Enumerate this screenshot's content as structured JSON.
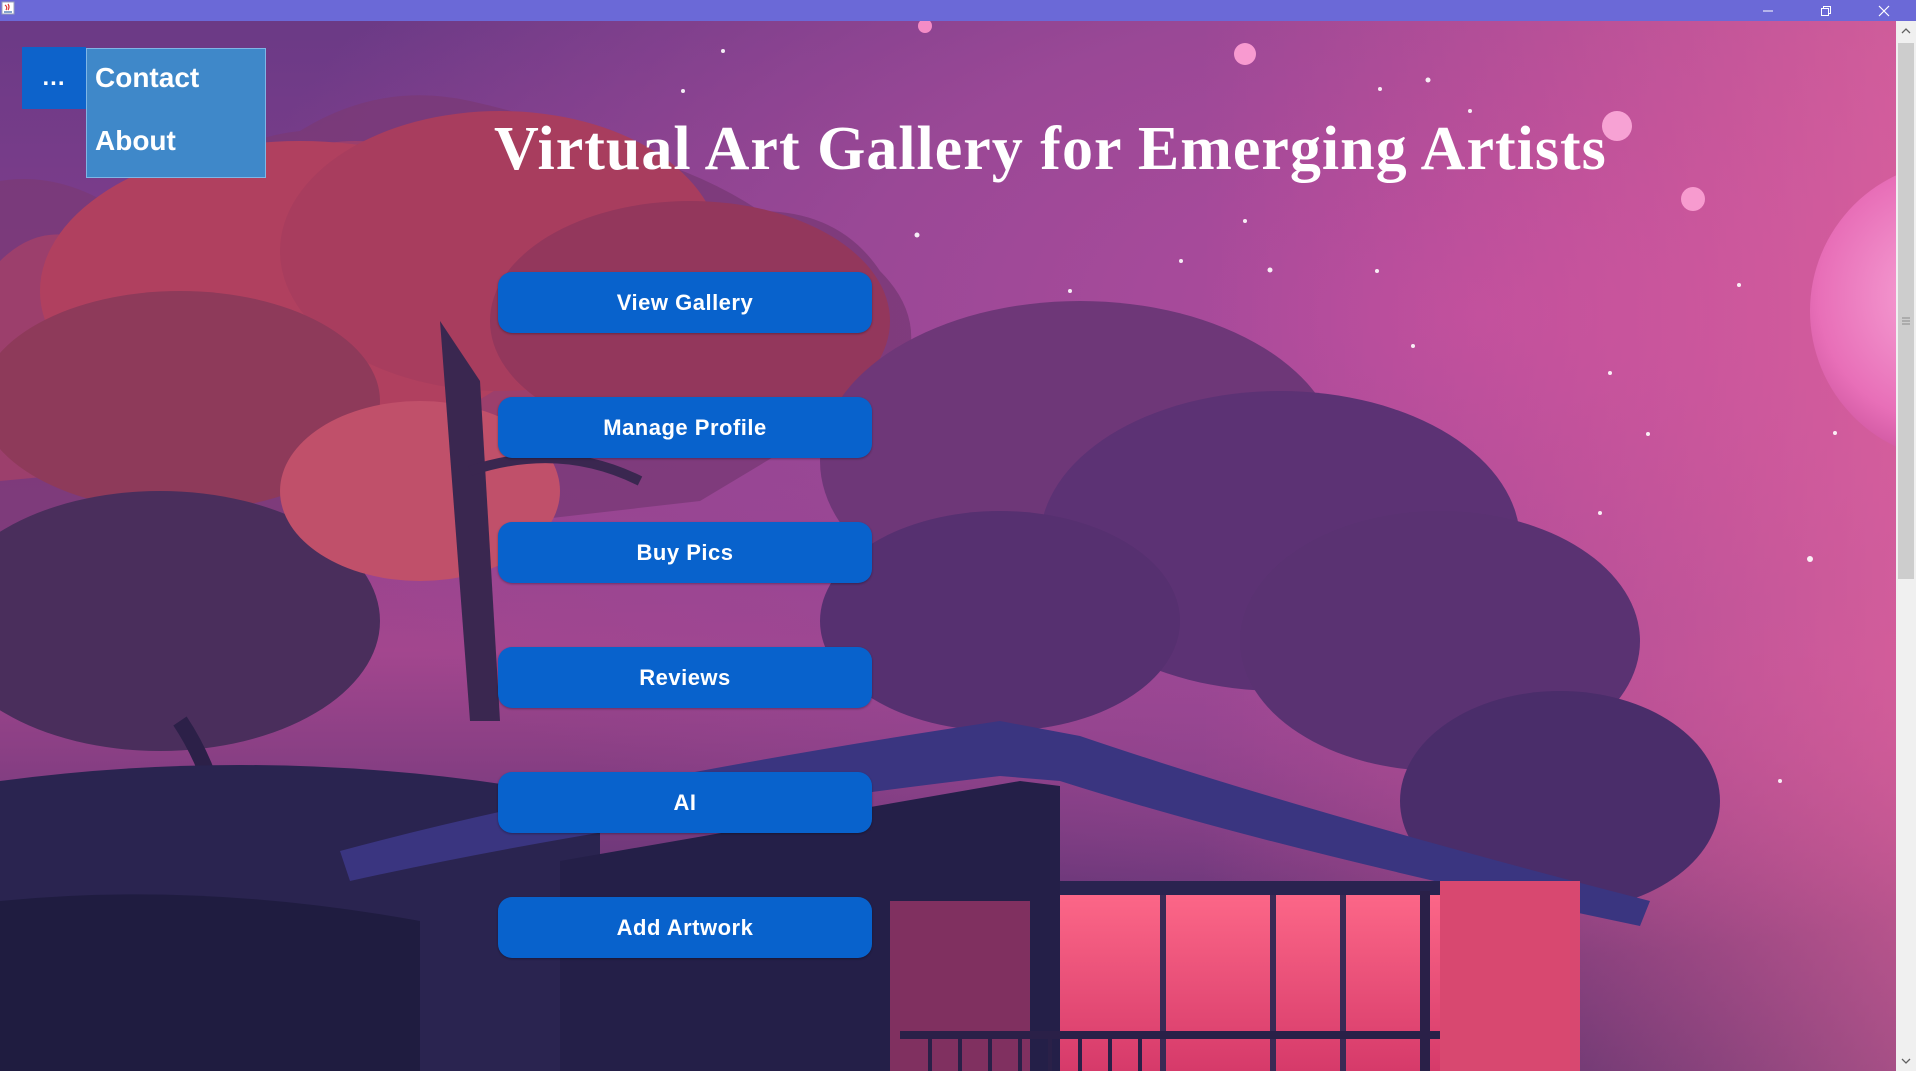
{
  "window": {
    "minimize_icon": "minimize-icon",
    "restore_icon": "restore-icon",
    "close_icon": "close-icon",
    "titlebar_color": "#6b69d7"
  },
  "menu": {
    "toggle_label": "...",
    "items": [
      {
        "label": "Contact"
      },
      {
        "label": "About"
      }
    ]
  },
  "header": {
    "title": "Virtual Art Gallery for Emerging Artists"
  },
  "nav": {
    "buttons": [
      {
        "label": "View Gallery"
      },
      {
        "label": "Manage Profile"
      },
      {
        "label": "Buy Pics"
      },
      {
        "label": "Reviews"
      },
      {
        "label": "AI"
      },
      {
        "label": "Add Artwork"
      }
    ]
  },
  "colors": {
    "button": "#0862cc",
    "menu_popup": "#3f88c9",
    "menu_toggle": "#0d63cb"
  }
}
